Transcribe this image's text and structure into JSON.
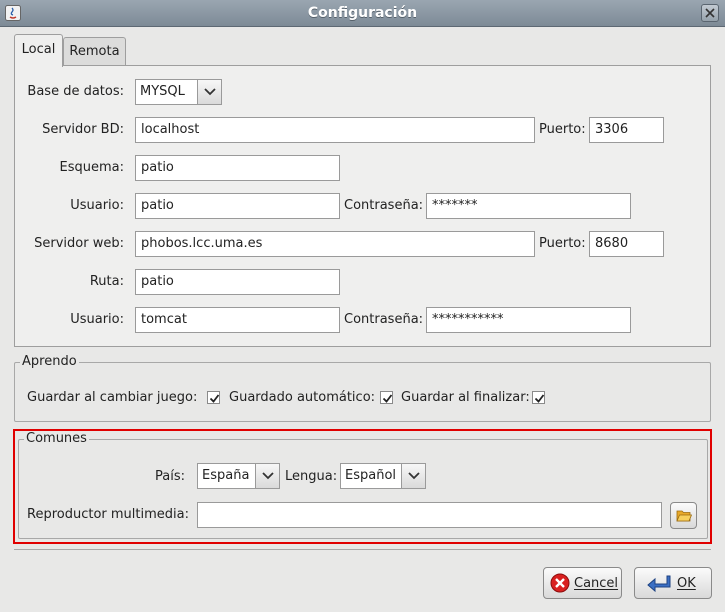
{
  "window": {
    "title": "Configuración"
  },
  "tabs": [
    {
      "label": "Local",
      "selected": true
    },
    {
      "label": "Remota",
      "selected": false
    }
  ],
  "local": {
    "db_label": "Base de datos:",
    "db_value": "MYSQL",
    "db_server_label": "Servidor BD:",
    "db_server_value": "localhost",
    "db_port_label": "Puerto:",
    "db_port_value": "3306",
    "schema_label": "Esquema:",
    "schema_value": "patio",
    "db_user_label": "Usuario:",
    "db_user_value": "patio",
    "db_password_label": "Contraseña:",
    "db_password_value": "*******",
    "web_server_label": "Servidor web:",
    "web_server_value": "phobos.lcc.uma.es",
    "web_port_label": "Puerto:",
    "web_port_value": "8680",
    "path_label": "Ruta:",
    "path_value": "patio",
    "web_user_label": "Usuario:",
    "web_user_value": "tomcat",
    "web_password_label": "Contraseña:",
    "web_password_value": "***********"
  },
  "aprendo": {
    "title": "Aprendo",
    "save_on_change_label": "Guardar al cambiar juego:",
    "save_on_change_checked": true,
    "autosave_label": "Guardado automático:",
    "autosave_checked": true,
    "save_on_finish_label": "Guardar al finalizar:",
    "save_on_finish_checked": true
  },
  "comunes": {
    "title": "Comunes",
    "country_label": "País:",
    "country_value": "España",
    "language_label": "Lengua:",
    "language_value": "Español",
    "media_player_label": "Reproductor multimedia:",
    "media_player_value": ""
  },
  "buttons": {
    "cancel_label": "Cancel",
    "ok_label": "OK"
  },
  "colors": {
    "highlight_border": "#e00000",
    "titlebar": "#8a96a2",
    "cancel_icon": "#d92020",
    "ok_icon": "#3a6fc4"
  }
}
